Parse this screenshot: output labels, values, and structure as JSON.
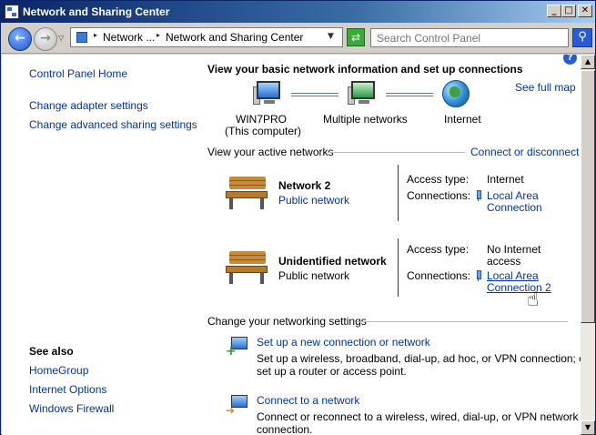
{
  "window": {
    "title": "Network and Sharing Center",
    "buttons": {
      "minimize": "_",
      "maximize": "□",
      "close": "✕"
    }
  },
  "navbar": {
    "back_glyph": "←",
    "forward_glyph": "→",
    "history_glyph": "▽",
    "crumbs": [
      "Network ...",
      "Network and Sharing Center"
    ],
    "crumb_separator": "▸",
    "address_dropdown_glyph": "▼",
    "refresh_glyph": "⇄",
    "search_placeholder": "Search Control Panel",
    "search_glyph": "⚲"
  },
  "left_pane": {
    "home": "Control Panel Home",
    "tasks": [
      "Change adapter settings",
      "Change advanced sharing settings"
    ],
    "see_also_heading": "See also",
    "see_also": [
      "HomeGroup",
      "Internet Options",
      "Windows Firewall"
    ]
  },
  "main": {
    "help_glyph": "?",
    "heading": "View your basic network information and set up connections",
    "see_full_map": "See full map",
    "map": {
      "computer_name": "WIN7PRO",
      "computer_sub": "(This computer)",
      "middle": "Multiple networks",
      "internet": "Internet"
    },
    "active_heading": "View your active networks",
    "connect_disconnect": "Connect or disconnect",
    "networks": [
      {
        "name": "Network  2",
        "category": "Public network",
        "access_label": "Access type:",
        "access_value": "Internet",
        "connections_label": "Connections:",
        "connection_line1": "Local Area",
        "connection_line2": "Connection"
      },
      {
        "name": "Unidentified network",
        "category": "Public network",
        "access_label": "Access type:",
        "access_value_line1": "No Internet",
        "access_value_line2": "access",
        "connections_label": "Connections:",
        "connection_line1": "Local Area",
        "connection_line2": "Connection 2"
      }
    ],
    "change_heading": "Change your networking settings",
    "tasks": [
      {
        "title": "Set up a new connection or network",
        "desc_line1": "Set up a wireless, broadband, dial-up, ad hoc, or VPN connection; or",
        "desc_line2": "set up a router or access point."
      },
      {
        "title": "Connect to a network",
        "desc_line1": "Connect or reconnect to a wireless, wired, dial-up, or VPN network",
        "desc_line2": "connection."
      }
    ]
  },
  "scrollbar": {
    "up_glyph": "▲",
    "down_glyph": "▼"
  },
  "cursor_glyph": "☝"
}
